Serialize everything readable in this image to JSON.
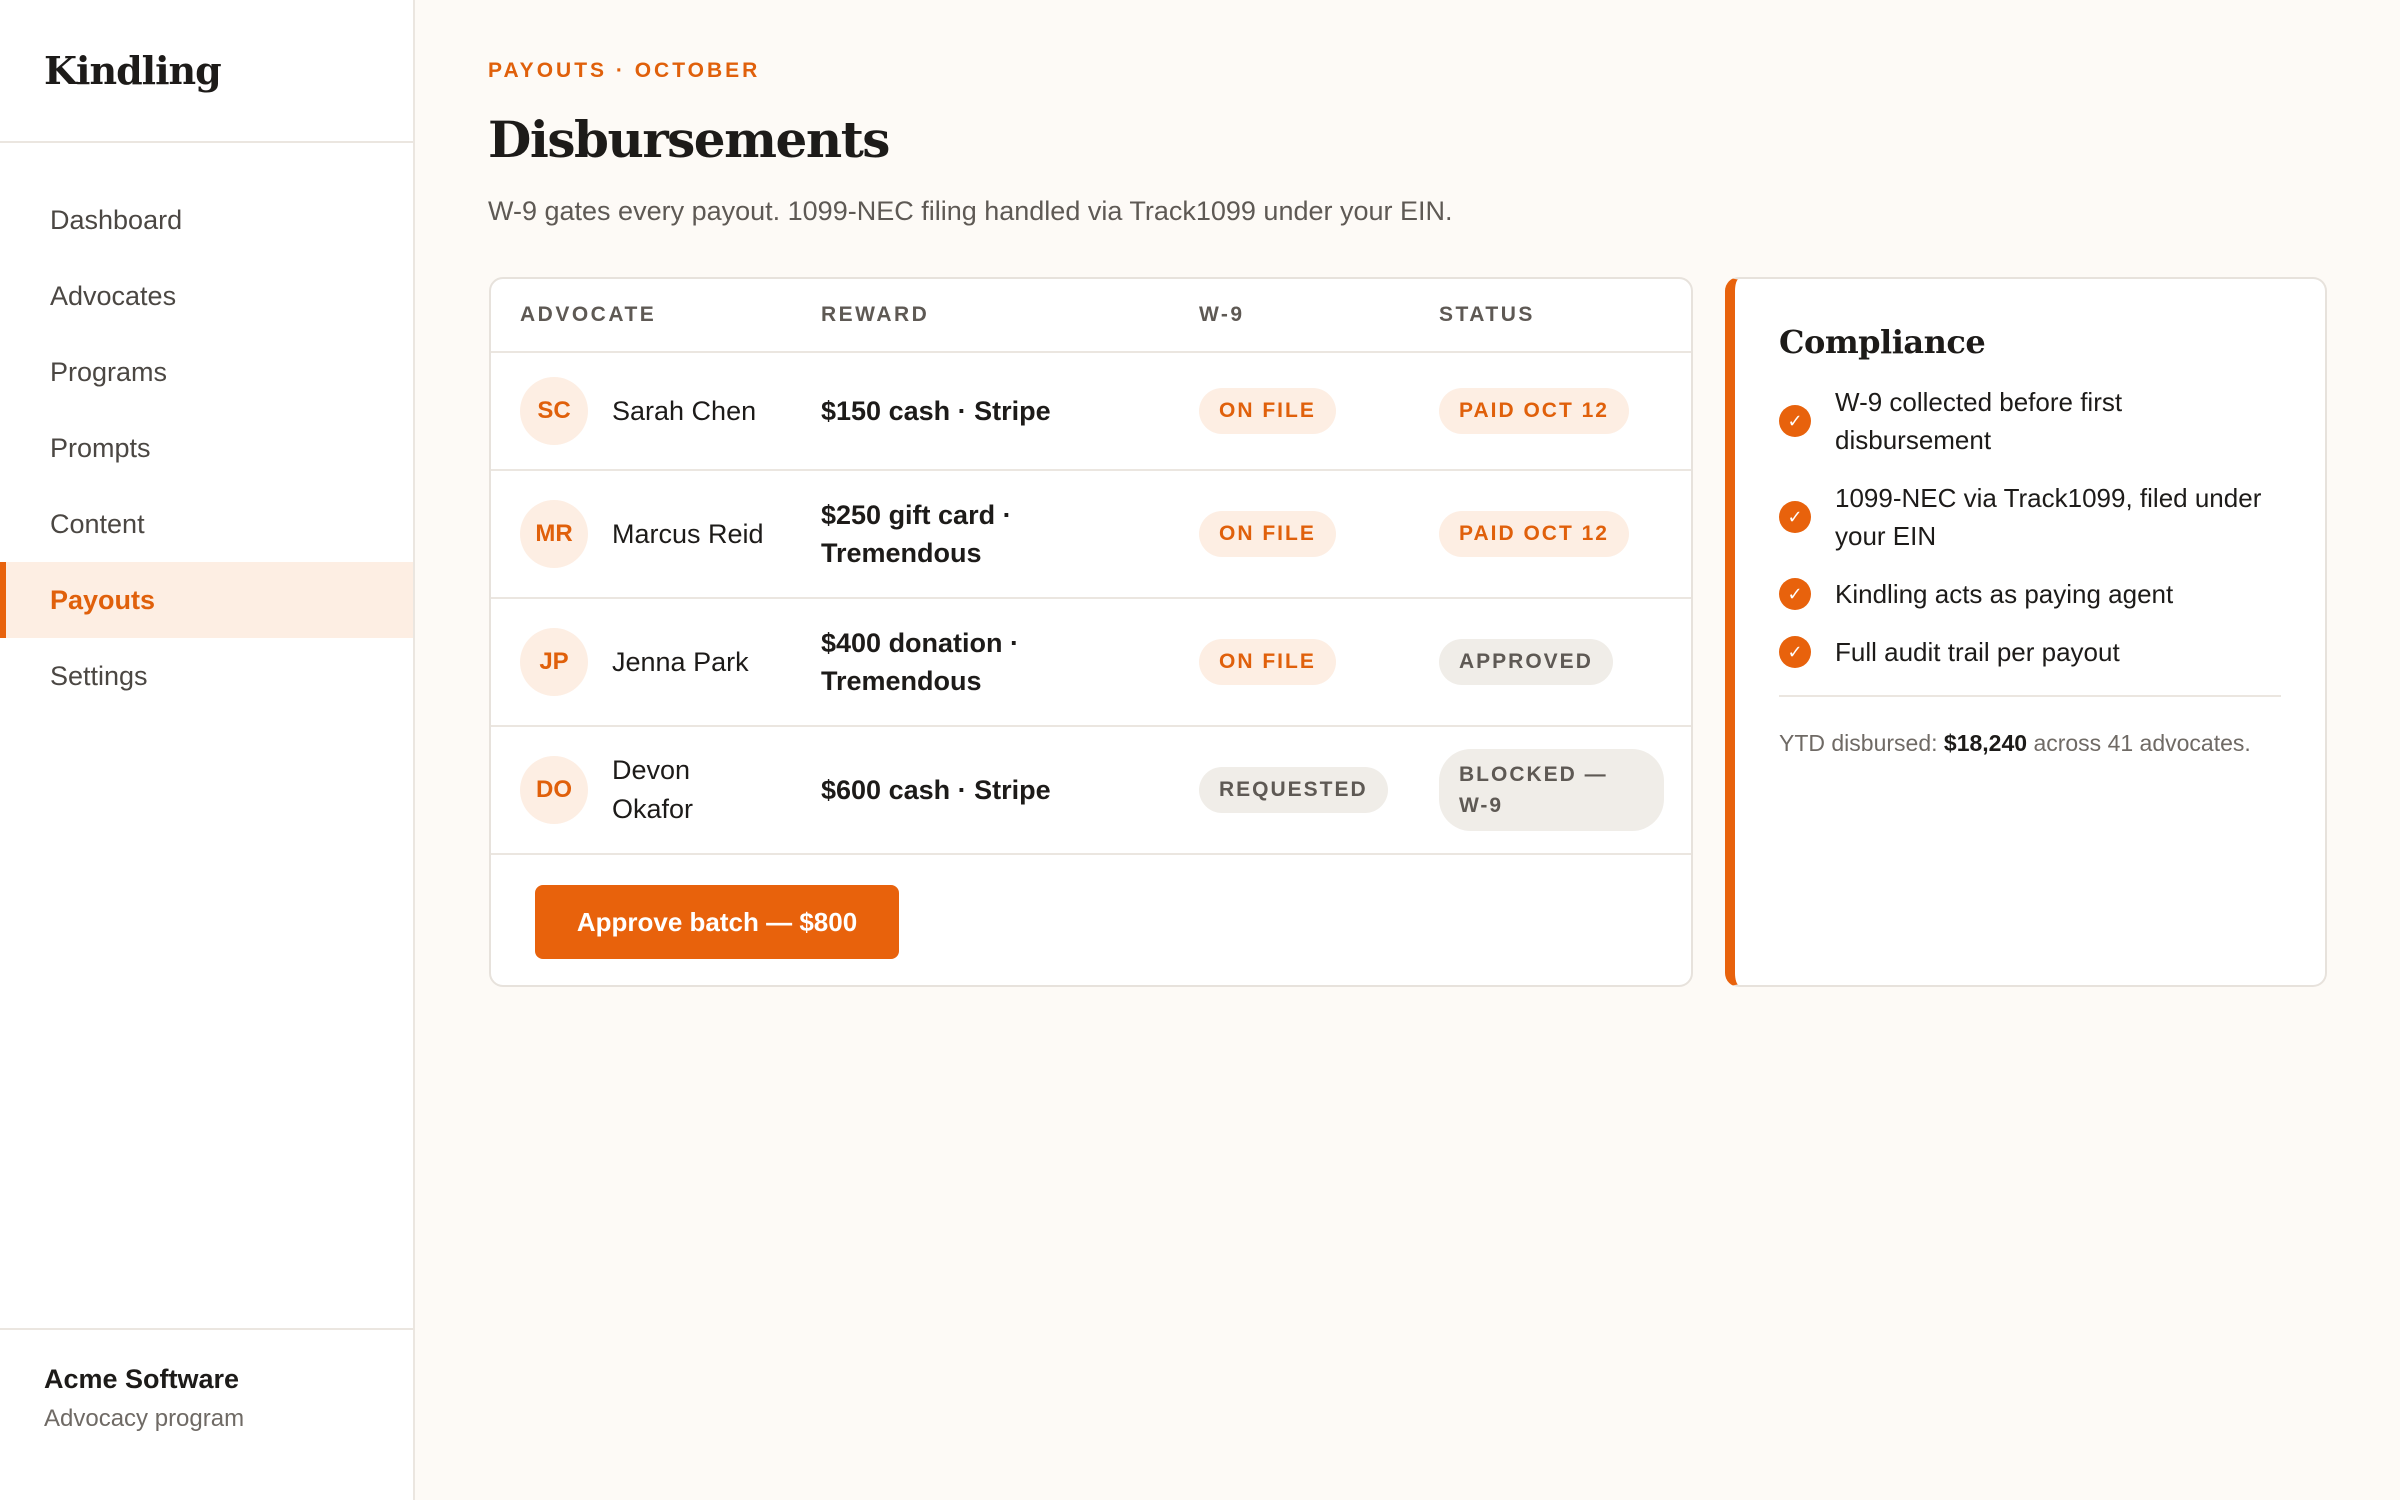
{
  "brand": "Kindling",
  "nav": [
    {
      "label": "Dashboard",
      "active": false
    },
    {
      "label": "Advocates",
      "active": false
    },
    {
      "label": "Programs",
      "active": false
    },
    {
      "label": "Prompts",
      "active": false
    },
    {
      "label": "Content",
      "active": false
    },
    {
      "label": "Payouts",
      "active": true
    },
    {
      "label": "Settings",
      "active": false
    }
  ],
  "org": {
    "name": "Acme Software",
    "subtitle": "Advocacy program"
  },
  "header": {
    "eyebrow": "PAYOUTS · OCTOBER",
    "title": "Disbursements",
    "subtitle": "W-9 gates every payout. 1099-NEC filing handled via Track1099 under your EIN."
  },
  "table": {
    "columns": [
      "ADVOCATE",
      "REWARD",
      "W-9",
      "STATUS"
    ],
    "rows": [
      {
        "initials": "SC",
        "name": "Sarah Chen",
        "reward": "$150 cash · Stripe",
        "w9": "ON FILE",
        "status": "PAID OCT 12"
      },
      {
        "initials": "MR",
        "name": "Marcus Reid",
        "reward": "$250 gift card · Tremendous",
        "w9": "ON FILE",
        "status": "PAID OCT 12"
      },
      {
        "initials": "JP",
        "name": "Jenna Park",
        "reward": "$400 donation · Tremendous",
        "w9": "ON FILE",
        "status": "APPROVED"
      },
      {
        "initials": "DO",
        "name": "Devon Okafor",
        "reward": "$600 cash · Stripe",
        "w9": "REQUESTED",
        "status": "BLOCKED — W-9"
      }
    ],
    "approve_label": "Approve batch — $800"
  },
  "compliance": {
    "title": "Compliance",
    "items": [
      "W-9 collected before first disbursement",
      "1099-NEC via Track1099, filed under your EIN",
      "Kindling acts as paying agent",
      "Full audit trail per payout"
    ],
    "check_glyph": "✓",
    "ytd_prefix": "YTD disbursed:",
    "ytd_amount": "$18,240",
    "ytd_suffix": "across 41 advocates."
  },
  "colors": {
    "accent": "#e8620c",
    "accent_soft": "#fdeee3",
    "neutral_pill": "#f0ede8"
  },
  "icons": {
    "check": "check-circle-icon"
  }
}
